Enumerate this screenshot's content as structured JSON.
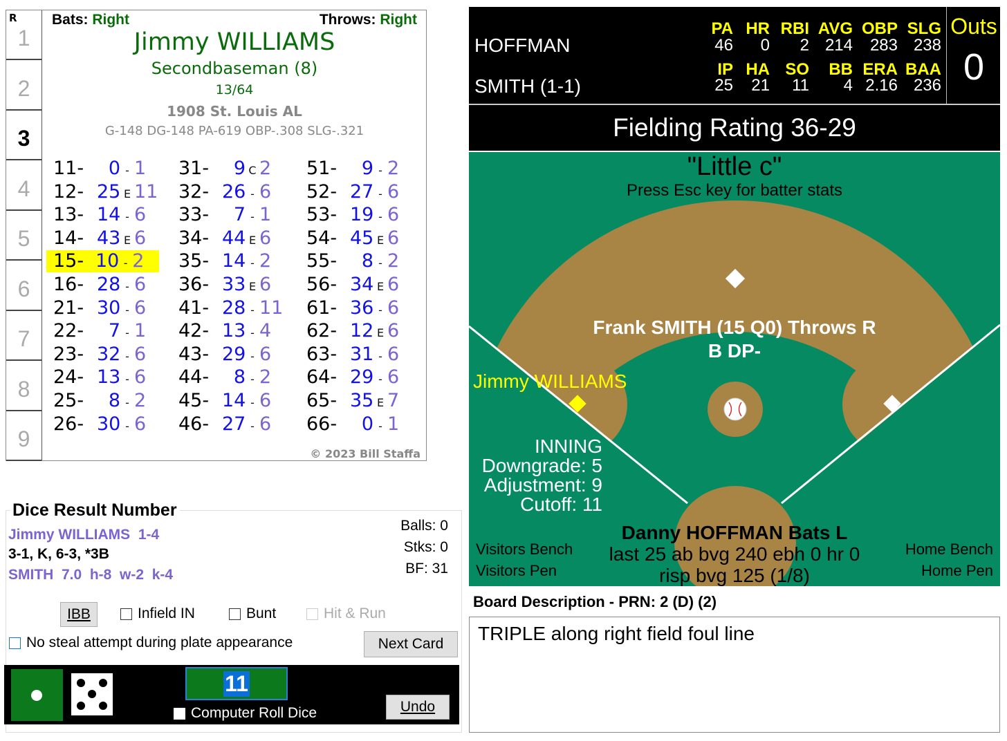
{
  "card": {
    "row_label": "R",
    "rows": [
      "1",
      "2",
      "3",
      "4",
      "5",
      "6",
      "7",
      "8",
      "9"
    ],
    "current_row": "3",
    "bats_label": "Bats:",
    "bats": "Right",
    "throws_label": "Throws:",
    "throws": "Right",
    "player_name": "Jimmy WILLIAMS",
    "position": "Secondbaseman (8)",
    "fraction": "13/64",
    "team": "1908 St. Louis AL",
    "season_stats": "G-148 DG-148 PA-619 OBP-.308 SLG-.321",
    "copyright": "© 2023 Bill Staffa",
    "highlighted_roll": "15-",
    "columns": [
      [
        [
          "11-",
          "0",
          "-",
          "1"
        ],
        [
          "12-",
          "25",
          "E",
          "11"
        ],
        [
          "13-",
          "14",
          "-",
          "6"
        ],
        [
          "14-",
          "43",
          "E",
          "6"
        ],
        [
          "15-",
          "10",
          "-",
          "2"
        ],
        [
          "16-",
          "28",
          "-",
          "6"
        ],
        [
          "21-",
          "30",
          "-",
          "6"
        ],
        [
          "22-",
          "7",
          "-",
          "1"
        ],
        [
          "23-",
          "32",
          "-",
          "6"
        ],
        [
          "24-",
          "13",
          "-",
          "6"
        ],
        [
          "25-",
          "8",
          "-",
          "2"
        ],
        [
          "26-",
          "30",
          "-",
          "6"
        ]
      ],
      [
        [
          "31-",
          "9",
          "C",
          "2"
        ],
        [
          "32-",
          "26",
          "-",
          "6"
        ],
        [
          "33-",
          "7",
          "-",
          "1"
        ],
        [
          "34-",
          "44",
          "E",
          "6"
        ],
        [
          "35-",
          "14",
          "-",
          "2"
        ],
        [
          "36-",
          "33",
          "E",
          "6"
        ],
        [
          "41-",
          "28",
          "-",
          "11"
        ],
        [
          "42-",
          "13",
          "-",
          "4"
        ],
        [
          "43-",
          "29",
          "-",
          "6"
        ],
        [
          "44-",
          "8",
          "-",
          "2"
        ],
        [
          "45-",
          "14",
          "-",
          "6"
        ],
        [
          "46-",
          "27",
          "-",
          "6"
        ]
      ],
      [
        [
          "51-",
          "9",
          "-",
          "2"
        ],
        [
          "52-",
          "27",
          "-",
          "6"
        ],
        [
          "53-",
          "19",
          "-",
          "6"
        ],
        [
          "54-",
          "45",
          "E",
          "6"
        ],
        [
          "55-",
          "8",
          "-",
          "2"
        ],
        [
          "56-",
          "34",
          "E",
          "6"
        ],
        [
          "61-",
          "36",
          "-",
          "6"
        ],
        [
          "62-",
          "12",
          "E",
          "6"
        ],
        [
          "63-",
          "31",
          "-",
          "6"
        ],
        [
          "64-",
          "29",
          "-",
          "6"
        ],
        [
          "65-",
          "35",
          "E",
          "7"
        ],
        [
          "66-",
          "0",
          "-",
          "1"
        ]
      ]
    ]
  },
  "dice": {
    "title": "Dice Result Number",
    "batter_line": "Jimmy WILLIAMS  1-4",
    "results_line": "3-1, K, 6-3, *3B",
    "pitcher_line": "SMITH  7.0  h-8  w-2  k-4",
    "balls": "Balls: 0",
    "strikes": "Stks: 0",
    "bf": "BF: 31",
    "ibb_label": "IBB",
    "infield_in_label": "Infield IN",
    "bunt_label": "Bunt",
    "hit_run_label": "Hit & Run",
    "no_steal_label": "No steal attempt during plate appearance",
    "next_card_label": "Next Card",
    "roll_value": "11",
    "computer_roll_label": "Computer Roll Dice",
    "undo_label": "Undo",
    "die1": 1,
    "die2": 5
  },
  "scoreboard": {
    "batter": "HOFFMAN",
    "batter_headers": [
      "PA",
      "HR",
      "RBI",
      "AVG",
      "OBP",
      "SLG"
    ],
    "batter_values": [
      "46",
      "0",
      "2",
      "214",
      "283",
      "238"
    ],
    "pitcher": "SMITH (1-1)",
    "pitcher_headers": [
      "IP",
      "HA",
      "SO",
      "BB",
      "ERA",
      "BAA"
    ],
    "pitcher_values": [
      "25",
      "21",
      "11",
      "4",
      "2.16",
      "236"
    ],
    "outs_label": "Outs",
    "outs": "0"
  },
  "fielding_rating": "Fielding Rating 36-29",
  "field": {
    "title": "\"Little c\"",
    "hint": "Press Esc key for batter stats",
    "pitcher_info": "Frank SMITH (15 Q0) Throws R",
    "pitcher_sub": "B DP-",
    "runner": "Jimmy WILLIAMS",
    "inning_label": "INNING",
    "downgrade": "Downgrade: 5",
    "adjustment": "Adjustment: 9",
    "cutoff": "Cutoff: 11",
    "batter_info": "Danny HOFFMAN Bats L",
    "batter_last": "last 25 ab bvg 240 ebh 0 hr 0",
    "batter_risp": "risp bvg 125 (1/8)",
    "visitors_bench": "Visitors Bench",
    "visitors_pen": "Visitors Pen",
    "home_bench": "Home Bench",
    "home_pen": "Home Pen",
    "colors": {
      "grass": "#068a62",
      "dirt": "#a88445",
      "runner": "#ffff00"
    }
  },
  "board": {
    "label": "Board Description - PRN: 2 (D) (2)",
    "text": "TRIPLE along right field foul line"
  }
}
